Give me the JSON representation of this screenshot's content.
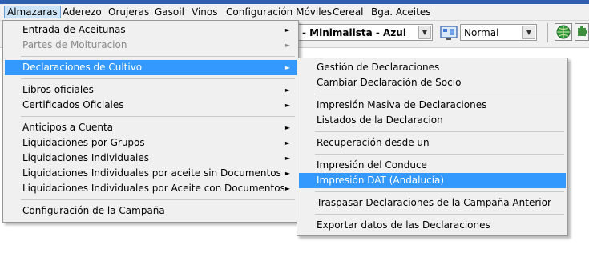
{
  "menubar": {
    "items": [
      {
        "label": "Almazaras"
      },
      {
        "label": "Aderezo"
      },
      {
        "label": "Orujeras"
      },
      {
        "label": "Gasoil"
      },
      {
        "label": "Vinos"
      },
      {
        "label": "Configuración Móviles"
      },
      {
        "label": "Cereal"
      },
      {
        "label": "Bga. Aceites"
      }
    ]
  },
  "toolbar": {
    "theme_value": "- Minimalista - Azul",
    "view_value": "Normal"
  },
  "main_menu": {
    "items": [
      {
        "label": "Entrada de Aceitunas",
        "arrow": "►"
      },
      {
        "label": "Partes de Molturacion",
        "arrow": "►"
      },
      {
        "label": "Declaraciones de Cultivo",
        "arrow": "►"
      },
      {
        "label": "Libros oficiales",
        "arrow": "►"
      },
      {
        "label": "Certificados Oficiales",
        "arrow": "►"
      },
      {
        "label": "Anticipos a Cuenta",
        "arrow": "►"
      },
      {
        "label": "Liquidaciones por Grupos",
        "arrow": "►"
      },
      {
        "label": "Liquidaciones Individuales",
        "arrow": "►"
      },
      {
        "label": "Liquidaciones Individuales por aceite sin Documentos",
        "arrow": "►"
      },
      {
        "label": "Liquidaciones Individuales por Aceite con Documentos",
        "arrow": "►"
      },
      {
        "label": "Configuración de la Campaña"
      }
    ]
  },
  "submenu": {
    "items": [
      {
        "label": "Gestión de Declaraciones"
      },
      {
        "label": "Cambiar Declaración de Socio"
      },
      {
        "label": "Impresión Masiva de Declaraciones"
      },
      {
        "label": "Listados de la Declaracion"
      },
      {
        "label": "Recuperación desde un"
      },
      {
        "label": "Impresión del Conduce"
      },
      {
        "label": "Impresión DAT (Andalucía)"
      },
      {
        "label": "Traspasar Declaraciones de la Campaña Anterior"
      },
      {
        "label": "Exportar datos de las Declaraciones"
      }
    ]
  },
  "colors": {
    "highlight": "#3399ff",
    "menubar_active": "#cce4f7",
    "disabled_text": "#8a8a8a"
  }
}
